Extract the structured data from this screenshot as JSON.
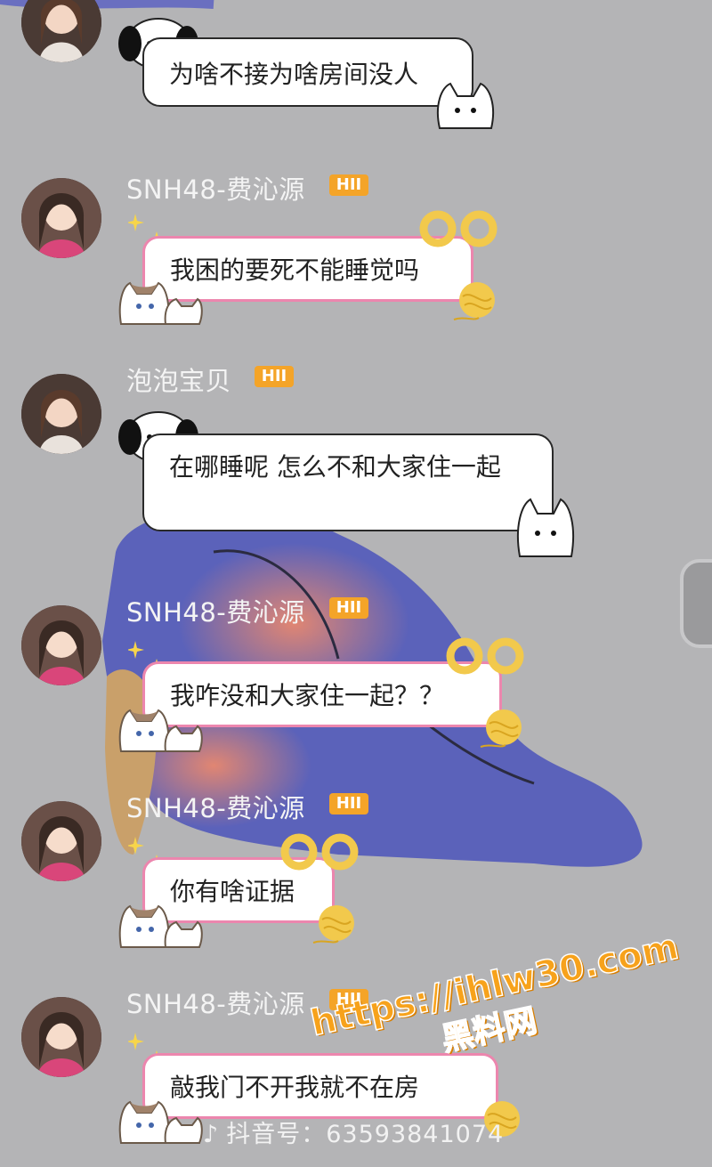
{
  "messages": [
    {
      "username": "",
      "badge": "",
      "text": "为啥不接为啥房间没人",
      "style": "dog"
    },
    {
      "username": "SNH48-费沁源",
      "badge": "HII",
      "text": "我困的要死不能睡觉吗",
      "style": "cat"
    },
    {
      "username": "泡泡宝贝",
      "badge": "HII",
      "text": "在哪睡呢 怎么不和大家住一起",
      "style": "dog"
    },
    {
      "username": "SNH48-费沁源",
      "badge": "HII",
      "text": "我咋没和大家住一起？？",
      "style": "cat"
    },
    {
      "username": "SNH48-费沁源",
      "badge": "HII",
      "text": "你有啥证据",
      "style": "cat"
    },
    {
      "username": "SNH48-费沁源",
      "badge": "HII",
      "text": "敲我门不开我就不在房",
      "style": "cat"
    }
  ],
  "footer": {
    "app_glyph": "♪",
    "douyin_id": "抖音号：63593841074"
  },
  "watermark": {
    "url": "https://ihlw30.com",
    "site": "黑料网"
  },
  "colors": {
    "badge": "#f4a428",
    "bubble_border": "#ec86ae",
    "background": "#b4b4b6"
  }
}
